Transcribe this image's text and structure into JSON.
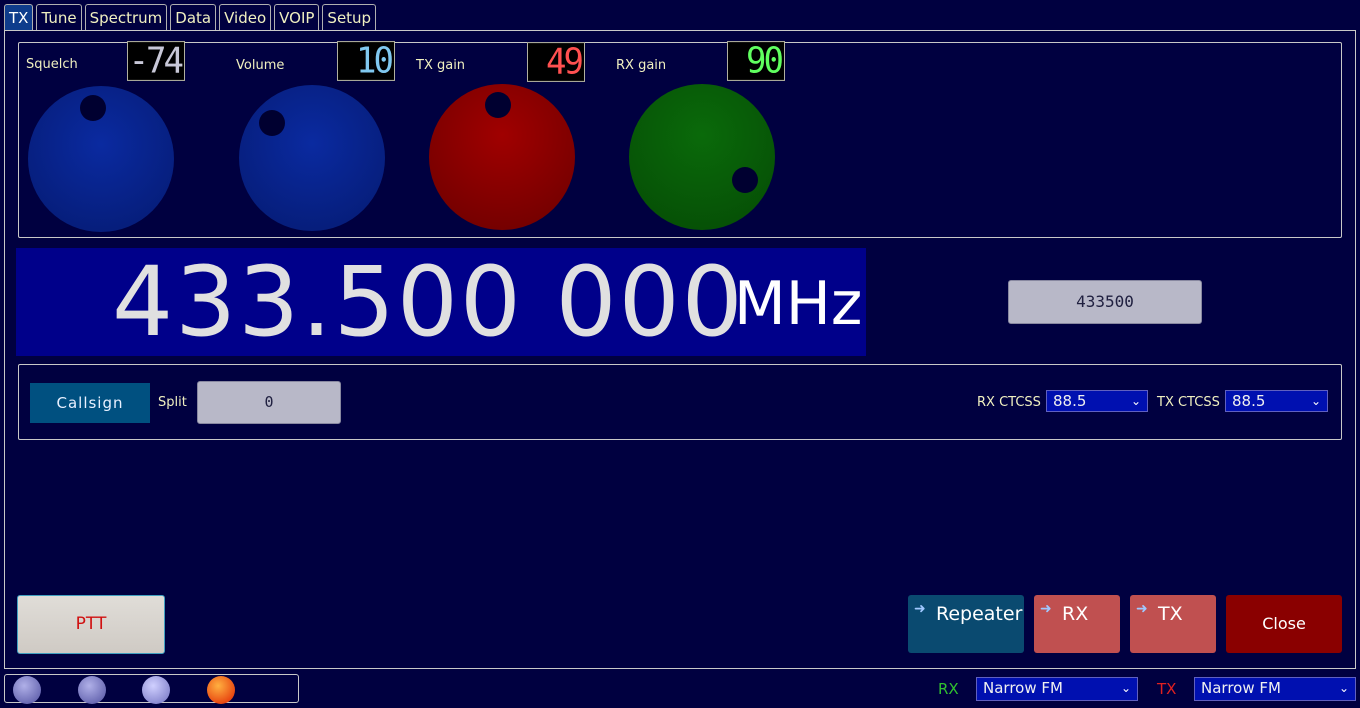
{
  "tabs": [
    {
      "label": "TX",
      "active": true
    },
    {
      "label": "Tune"
    },
    {
      "label": "Spectrum"
    },
    {
      "label": "Data"
    },
    {
      "label": "Video"
    },
    {
      "label": "VOIP"
    },
    {
      "label": "Setup"
    }
  ],
  "knobs": {
    "squelch": {
      "label": "Squelch",
      "value": "-74",
      "color": "#0a2a9a",
      "lcd_color": "#c8c8d8"
    },
    "volume": {
      "label": "Volume",
      "value": "10",
      "color": "#0a2a9a",
      "lcd_color": "#80c8f0"
    },
    "tx_gain": {
      "label": "TX gain",
      "value": "49",
      "color": "#8a0000",
      "lcd_color": "#ff5050"
    },
    "rx_gain": {
      "label": "RX gain",
      "value": "90",
      "color": "#0a5a0a",
      "lcd_color": "#60ff60"
    }
  },
  "frequency": {
    "digits": "433.500 000",
    "unit": "MHz",
    "entry_value": "433500"
  },
  "settings": {
    "callsign_label": "Callsign",
    "split_label": "Split",
    "split_value": "0",
    "rx_ctcss_label": "RX CTCSS",
    "rx_ctcss_value": "88.5",
    "tx_ctcss_label": "TX CTCSS",
    "tx_ctcss_value": "88.5"
  },
  "buttons": {
    "ptt": "PTT",
    "repeater": "Repeater",
    "rx": "RX",
    "tx": "TX",
    "close": "Close"
  },
  "footer": {
    "rx_label": "RX",
    "rx_mode": "Narrow FM",
    "tx_label": "TX",
    "tx_mode": "Narrow FM",
    "rx_color": "#30c030",
    "tx_color": "#e02020"
  },
  "colors": {
    "background": "#000040",
    "freq_bg": "#00008a",
    "repeater_btn": "#0a4a70",
    "rx_tx_btn": "#c05050",
    "close_btn": "#8a0000"
  }
}
